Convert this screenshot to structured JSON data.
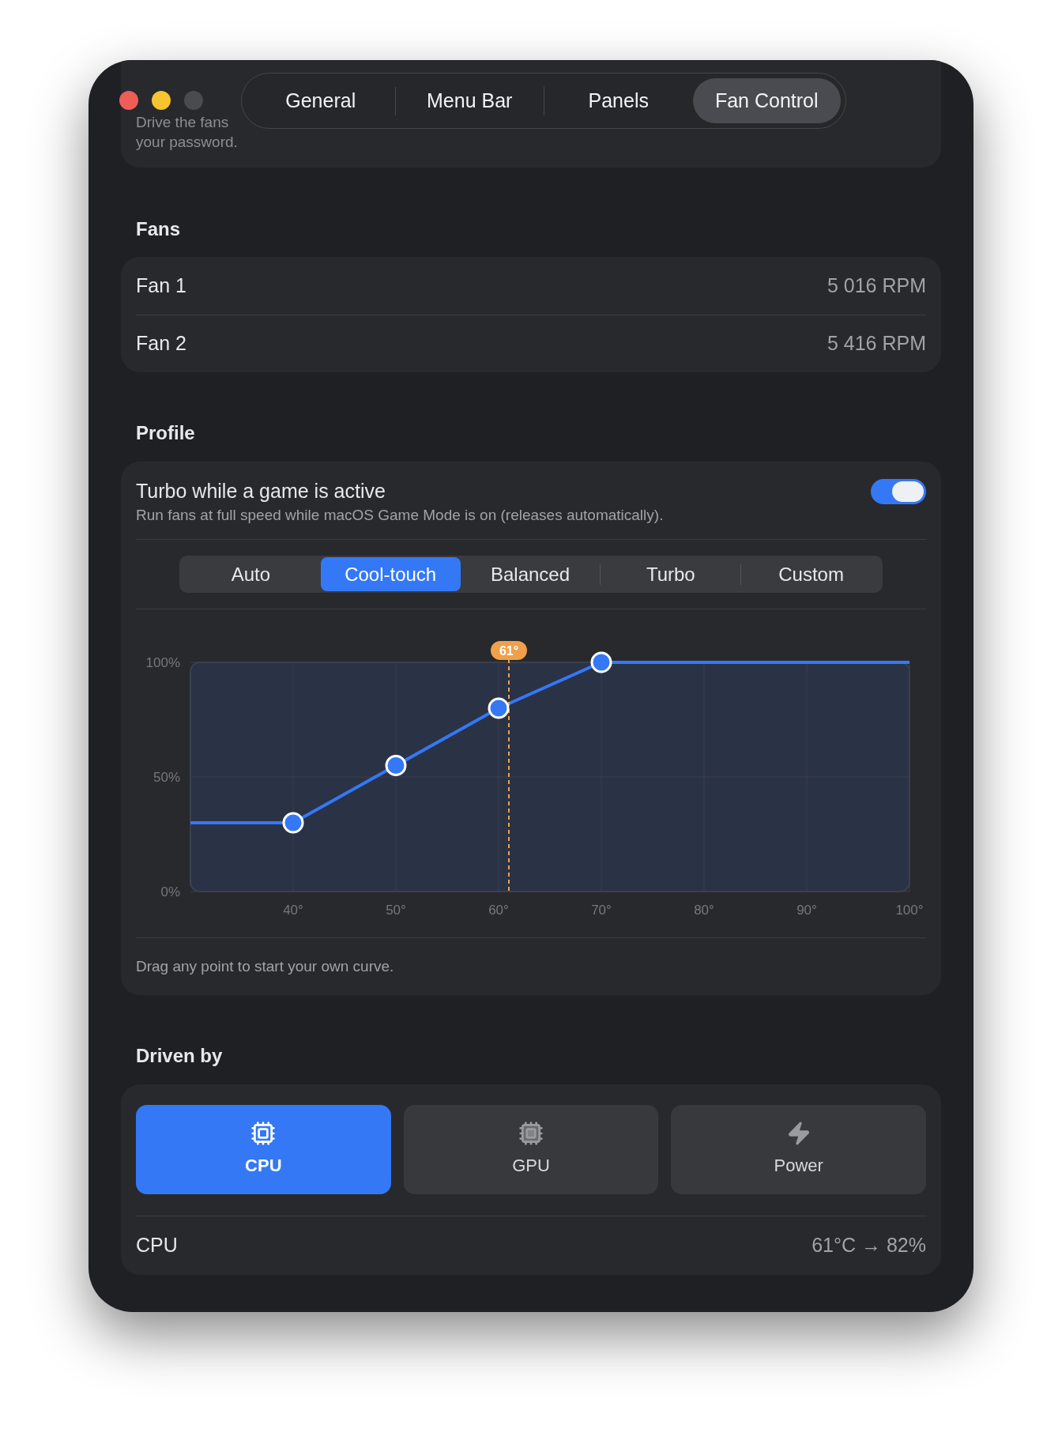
{
  "window": {
    "tabs": [
      {
        "label": "General",
        "selected": false
      },
      {
        "label": "Menu Bar",
        "selected": false
      },
      {
        "label": "Panels",
        "selected": false
      },
      {
        "label": "Fan Control",
        "selected": true
      }
    ]
  },
  "intro": {
    "line_1": "Drive the fans",
    "line_2": "your password."
  },
  "fans": {
    "heading": "Fans",
    "rows": [
      {
        "name": "Fan 1",
        "reading": "5 016 RPM"
      },
      {
        "name": "Fan 2",
        "reading": "5 416 RPM"
      }
    ]
  },
  "profile": {
    "heading": "Profile",
    "game_turbo": {
      "title": "Turbo while a game is active",
      "description": "Run fans at full speed while macOS Game Mode is on (releases automatically).",
      "on": true
    },
    "modes": [
      {
        "label": "Auto",
        "selected": false
      },
      {
        "label": "Cool-touch",
        "selected": true
      },
      {
        "label": "Balanced",
        "selected": false
      },
      {
        "label": "Turbo",
        "selected": false
      },
      {
        "label": "Custom",
        "selected": false
      }
    ],
    "chart_data": {
      "type": "line",
      "x": [
        30,
        40,
        50,
        60,
        70,
        100
      ],
      "series": [
        {
          "color": "#3478f6",
          "values": [
            30,
            30,
            55,
            80,
            100,
            100
          ]
        }
      ],
      "grid": true,
      "xlim": [
        30,
        100
      ],
      "ylim": [
        0,
        100
      ],
      "xticks": [
        {
          "value": 40,
          "label": "40°"
        },
        {
          "value": 50,
          "label": "50°"
        },
        {
          "value": 60,
          "label": "60°"
        },
        {
          "value": 70,
          "label": "70°"
        },
        {
          "value": 80,
          "label": "80°"
        },
        {
          "value": 90,
          "label": "90°"
        },
        {
          "value": 100,
          "label": "100°"
        }
      ],
      "yticks": [
        {
          "value": 0,
          "label": "0%"
        },
        {
          "value": 50,
          "label": "50%"
        },
        {
          "value": 100,
          "label": "100%"
        }
      ],
      "ref_lines": [
        {
          "axis": "x",
          "value": 61,
          "color": "#f0a04b"
        }
      ],
      "annotations": [
        {
          "x": 61,
          "y": 100,
          "text": "61°"
        }
      ]
    },
    "hint": "Drag any point to start your own curve."
  },
  "driven_by": {
    "heading": "Driven by",
    "sources": [
      {
        "kind": "cpu",
        "label": "CPU",
        "selected": true
      },
      {
        "kind": "gpu",
        "label": "GPU",
        "selected": false
      },
      {
        "kind": "power",
        "label": "Power",
        "selected": false
      }
    ],
    "status": {
      "label": "CPU",
      "reading": "61°C → 82%"
    }
  }
}
